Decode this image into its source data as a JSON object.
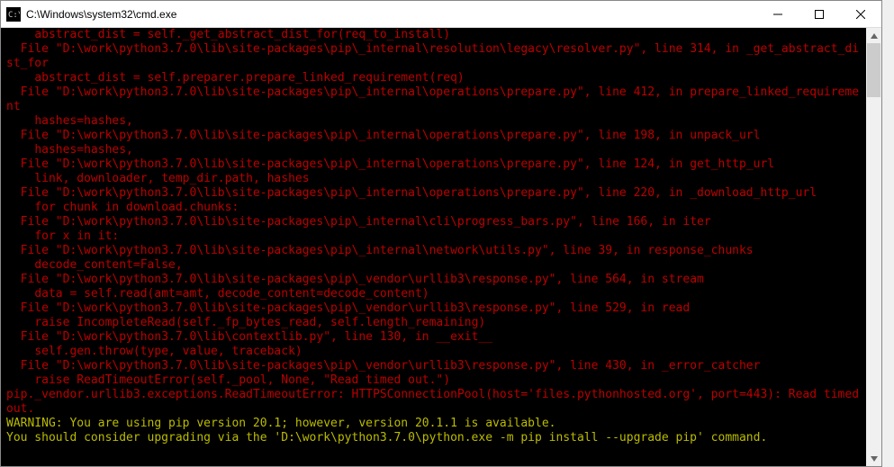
{
  "window": {
    "title": "C:\\Windows\\system32\\cmd.exe"
  },
  "lines": [
    {
      "cls": "red",
      "text": "    abstract_dist = self._get_abstract_dist_for(req_to_install)"
    },
    {
      "cls": "red",
      "text": "  File \"D:\\work\\python3.7.0\\lib\\site-packages\\pip\\_internal\\resolution\\legacy\\resolver.py\", line 314, in _get_abstract_dist_for"
    },
    {
      "cls": "red",
      "text": "    abstract_dist = self.preparer.prepare_linked_requirement(req)"
    },
    {
      "cls": "red",
      "text": "  File \"D:\\work\\python3.7.0\\lib\\site-packages\\pip\\_internal\\operations\\prepare.py\", line 412, in prepare_linked_requirement"
    },
    {
      "cls": "red",
      "text": "    hashes=hashes,"
    },
    {
      "cls": "red",
      "text": "  File \"D:\\work\\python3.7.0\\lib\\site-packages\\pip\\_internal\\operations\\prepare.py\", line 198, in unpack_url"
    },
    {
      "cls": "red",
      "text": "    hashes=hashes,"
    },
    {
      "cls": "red",
      "text": "  File \"D:\\work\\python3.7.0\\lib\\site-packages\\pip\\_internal\\operations\\prepare.py\", line 124, in get_http_url"
    },
    {
      "cls": "red",
      "text": "    link, downloader, temp_dir.path, hashes"
    },
    {
      "cls": "red",
      "text": "  File \"D:\\work\\python3.7.0\\lib\\site-packages\\pip\\_internal\\operations\\prepare.py\", line 220, in _download_http_url"
    },
    {
      "cls": "red",
      "text": "    for chunk in download.chunks:"
    },
    {
      "cls": "red",
      "text": "  File \"D:\\work\\python3.7.0\\lib\\site-packages\\pip\\_internal\\cli\\progress_bars.py\", line 166, in iter"
    },
    {
      "cls": "red",
      "text": "    for x in it:"
    },
    {
      "cls": "red",
      "text": "  File \"D:\\work\\python3.7.0\\lib\\site-packages\\pip\\_internal\\network\\utils.py\", line 39, in response_chunks"
    },
    {
      "cls": "red",
      "text": "    decode_content=False,"
    },
    {
      "cls": "red",
      "text": "  File \"D:\\work\\python3.7.0\\lib\\site-packages\\pip\\_vendor\\urllib3\\response.py\", line 564, in stream"
    },
    {
      "cls": "red",
      "text": "    data = self.read(amt=amt, decode_content=decode_content)"
    },
    {
      "cls": "red",
      "text": "  File \"D:\\work\\python3.7.0\\lib\\site-packages\\pip\\_vendor\\urllib3\\response.py\", line 529, in read"
    },
    {
      "cls": "red",
      "text": "    raise IncompleteRead(self._fp_bytes_read, self.length_remaining)"
    },
    {
      "cls": "red",
      "text": "  File \"D:\\work\\python3.7.0\\lib\\contextlib.py\", line 130, in __exit__"
    },
    {
      "cls": "red",
      "text": "    self.gen.throw(type, value, traceback)"
    },
    {
      "cls": "red",
      "text": "  File \"D:\\work\\python3.7.0\\lib\\site-packages\\pip\\_vendor\\urllib3\\response.py\", line 430, in _error_catcher"
    },
    {
      "cls": "red",
      "text": "    raise ReadTimeoutError(self._pool, None, \"Read timed out.\")"
    },
    {
      "cls": "red",
      "text": "pip._vendor.urllib3.exceptions.ReadTimeoutError: HTTPSConnectionPool(host='files.pythonhosted.org', port=443): Read timed out."
    },
    {
      "cls": "yellow",
      "text": "WARNING: You are using pip version 20.1; however, version 20.1.1 is available."
    },
    {
      "cls": "yellow",
      "text": "You should consider upgrading via the 'D:\\work\\python3.7.0\\python.exe -m pip install --upgrade pip' command."
    }
  ]
}
